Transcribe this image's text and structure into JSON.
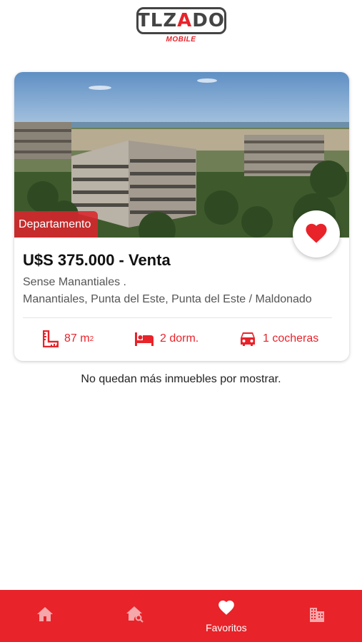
{
  "brand": {
    "logo_text_left": "TLZ",
    "logo_text_mid": "A",
    "logo_text_right": "DO",
    "logo_sub": "MOBILE"
  },
  "listing": {
    "type_badge": "Departamento",
    "price": "U$S 375.000 - Venta",
    "name": "Sense Manantiales .",
    "location": "Manantiales, Punta del Este, Punta del Este / Maldonado",
    "area_value": "87 m",
    "area_unit_sup": "2",
    "bedrooms": "2 dorm.",
    "garages": "1 cocheras",
    "favorite": true
  },
  "end_message": "No quedan más inmuebles por mostrar.",
  "bottom_nav": {
    "items": [
      {
        "icon": "home-icon",
        "label": ""
      },
      {
        "icon": "home-search-icon",
        "label": ""
      },
      {
        "icon": "heart-icon",
        "label": "Favoritos",
        "active": true
      },
      {
        "icon": "building-icon",
        "label": ""
      }
    ]
  },
  "colors": {
    "accent": "#e8232a",
    "text": "#222222",
    "muted": "#555555"
  }
}
